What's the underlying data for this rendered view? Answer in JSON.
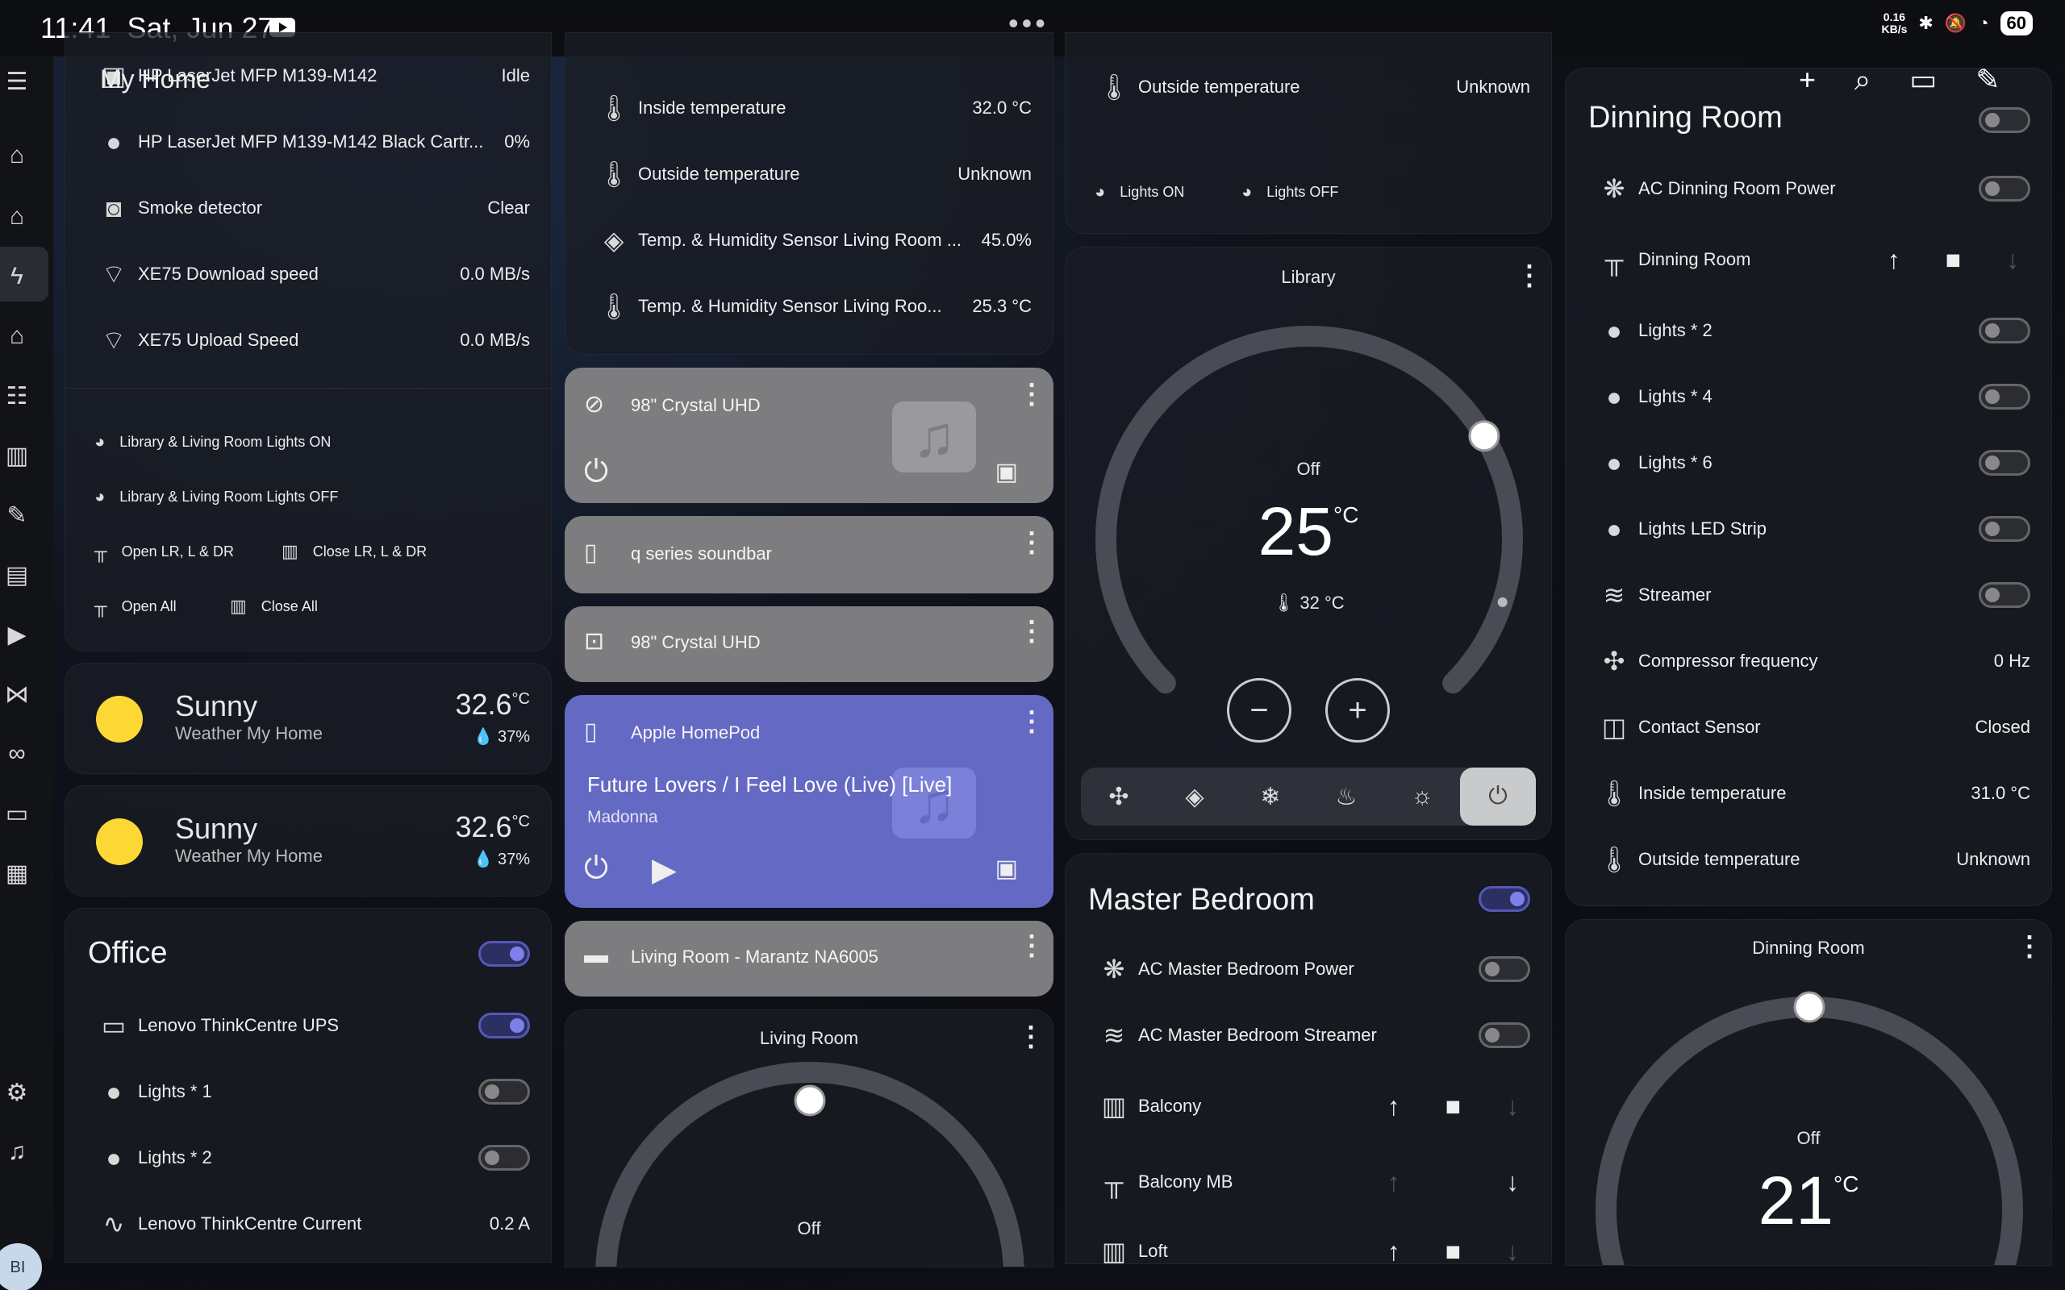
{
  "status_bar": {
    "time": "11:41",
    "date": "Sat, Jun 27",
    "net_speed": "0.16",
    "net_unit": "KB/s",
    "battery": "60"
  },
  "header": {
    "title": "My Home"
  },
  "top_icons": [
    "plus-icon",
    "search-icon",
    "assist-icon",
    "pencil-icon"
  ],
  "col1_list": [
    {
      "icon": "printer-icon",
      "label": "HP LaserJet MFP M139-M142",
      "value": "Idle"
    },
    {
      "icon": "water-drop-icon",
      "label": "HP LaserJet MFP M139-M142 Black Cartr...",
      "value": "0%"
    },
    {
      "icon": "smoke-detector-icon",
      "label": "Smoke detector",
      "value": "Clear"
    },
    {
      "icon": "wifi-icon",
      "label": "XE75 Download speed",
      "value": "0.0 MB/s"
    },
    {
      "icon": "wifi-icon",
      "label": "XE75 Upload Speed",
      "value": "0.0 MB/s"
    }
  ],
  "col1_buttons": {
    "lights_on": "Library & Living Room Lights ON",
    "lights_off": "Library & Living Room Lights OFF",
    "open_lr": "Open LR, L & DR",
    "close_lr": "Close LR, L & DR",
    "open_all": "Open All",
    "close_all": "Close All"
  },
  "weather": [
    {
      "condition": "Sunny",
      "location": "Weather My Home",
      "temp": "32.6",
      "unit": "°C",
      "humidity": "37%"
    },
    {
      "condition": "Sunny",
      "location": "Weather My Home",
      "temp": "32.6",
      "unit": "°C",
      "humidity": "37%"
    }
  ],
  "office": {
    "title": "Office",
    "items": [
      {
        "label": "Lenovo ThinkCentre UPS",
        "state": "on"
      },
      {
        "label": "Lights * 1",
        "state": "off"
      },
      {
        "label": "Lights * 2",
        "state": "off"
      },
      {
        "label": "Lenovo ThinkCentre Current",
        "value": "0.2 A"
      }
    ]
  },
  "col2_sensors": [
    {
      "label": "Inside temperature",
      "value": "32.0 °C"
    },
    {
      "label": "Outside temperature",
      "value": "Unknown"
    },
    {
      "label": "Temp. & Humidity Sensor Living Room ...",
      "value": "45.0%"
    },
    {
      "label": "Temp. & Humidity Sensor Living Roo...",
      "value": "25.3 °C"
    }
  ],
  "media": [
    {
      "name": "98\" Crystal UHD"
    },
    {
      "name": "q series soundbar"
    },
    {
      "name": "98\" Crystal UHD"
    },
    {
      "name": "Apple HomePod",
      "track": "Future Lovers / I Feel Love (Live) [Live]",
      "artist": "Madonna"
    },
    {
      "name": "Living Room - Marantz NA6005"
    }
  ],
  "living_thermo": {
    "title": "Living Room",
    "state": "Off"
  },
  "col3_top": {
    "label": "Outside temperature",
    "value": "Unknown",
    "lights_on": "Lights ON",
    "lights_off": "Lights OFF"
  },
  "library_thermo": {
    "title": "Library",
    "state": "Off",
    "target": "25",
    "unit": "°C",
    "current": "32 °C",
    "target_fraction": 0.72
  },
  "master_bedroom": {
    "title": "Master Bedroom",
    "items": [
      {
        "label": "AC Master Bedroom Power"
      },
      {
        "label": "AC Master Bedroom Streamer"
      },
      {
        "label": "Balcony"
      },
      {
        "label": "Balcony MB"
      },
      {
        "label": "Loft"
      }
    ]
  },
  "dinning_room": {
    "title": "Dinning Room",
    "items": [
      {
        "label": "AC Dinning Room Power"
      },
      {
        "label": "Dinning Room"
      },
      {
        "label": "Lights * 2"
      },
      {
        "label": "Lights * 4"
      },
      {
        "label": "Lights * 6"
      },
      {
        "label": "Lights LED Strip"
      },
      {
        "label": "Streamer"
      },
      {
        "label": "Compressor frequency",
        "value": "0 Hz"
      },
      {
        "label": "Contact Sensor",
        "value": "Closed"
      },
      {
        "label": "Inside temperature",
        "value": "31.0 °C"
      },
      {
        "label": "Outside temperature",
        "value": "Unknown"
      }
    ]
  },
  "dinning_thermo": {
    "title": "Dinning Room",
    "state": "Off",
    "target": "21",
    "unit": "°C",
    "target_fraction": 0.5
  }
}
